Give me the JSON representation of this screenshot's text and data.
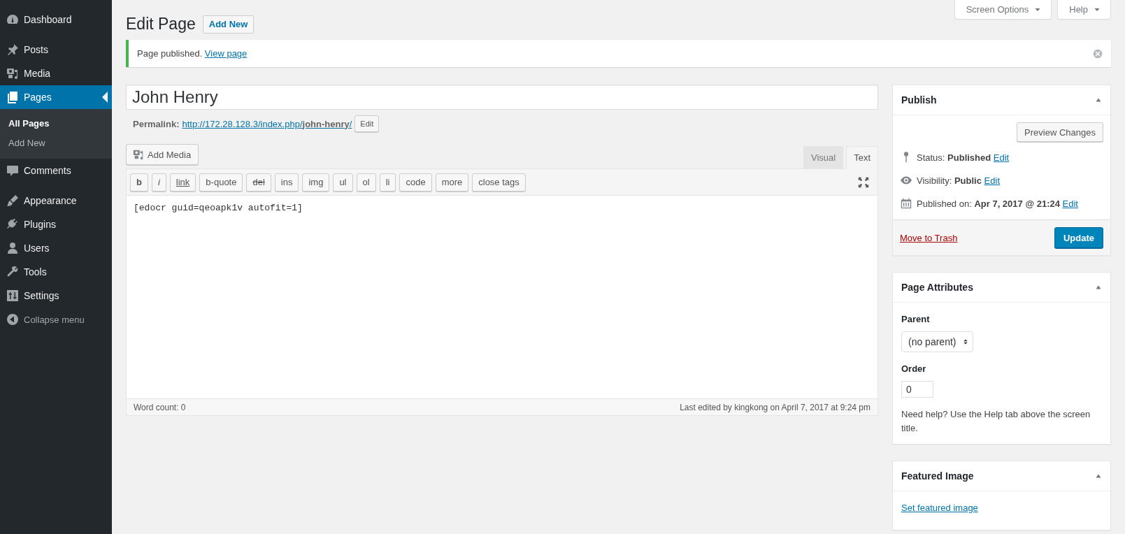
{
  "sidebar": {
    "items": [
      {
        "kind": "menu",
        "label": "Dashboard",
        "selected": false
      },
      {
        "kind": "separator"
      },
      {
        "kind": "menu",
        "label": "Posts",
        "selected": false
      },
      {
        "kind": "menu",
        "label": "Media",
        "selected": false
      },
      {
        "kind": "menu",
        "label": "Pages",
        "selected": true,
        "children": [
          {
            "label": "All Pages",
            "selected": true
          },
          {
            "label": "Add New",
            "selected": false
          }
        ]
      },
      {
        "kind": "menu",
        "label": "Comments",
        "selected": false
      },
      {
        "kind": "separator"
      },
      {
        "kind": "menu",
        "label": "Appearance",
        "selected": false
      },
      {
        "kind": "menu",
        "label": "Plugins",
        "selected": false
      },
      {
        "kind": "menu",
        "label": "Users",
        "selected": false
      },
      {
        "kind": "menu",
        "label": "Tools",
        "selected": false
      },
      {
        "kind": "menu",
        "label": "Settings",
        "selected": false
      }
    ],
    "collapse": "Collapse menu"
  },
  "screen_meta": [
    "Screen Options",
    "Help"
  ],
  "heading": {
    "title": "Edit Page",
    "add_new": "Add New"
  },
  "notice": {
    "message": "Page published.",
    "link": "View page"
  },
  "post_title": "John Henry",
  "permalink": {
    "label": "Permalink:",
    "url": "http://172.28.128.3/index.php/**john-henry**/",
    "edit": "Edit"
  },
  "editor": {
    "add_media": "Add Media",
    "tabs": [
      {
        "label": "Visual",
        "selected": false
      },
      {
        "label": "Text",
        "selected": true
      }
    ],
    "quicktags": [
      {
        "label": "b",
        "kind": "bold"
      },
      {
        "label": "i",
        "kind": "italic"
      },
      {
        "label": "link",
        "kind": "underline"
      },
      {
        "label": "b-quote",
        "kind": "plain"
      },
      {
        "label": "del",
        "kind": "strike"
      },
      {
        "label": "ins",
        "kind": "plain"
      },
      {
        "label": "img",
        "kind": "plain"
      },
      {
        "label": "ul",
        "kind": "plain"
      },
      {
        "label": "ol",
        "kind": "plain"
      },
      {
        "label": "li",
        "kind": "plain"
      },
      {
        "label": "code",
        "kind": "plain"
      },
      {
        "label": "more",
        "kind": "plain"
      },
      {
        "label": "close tags",
        "kind": "plain"
      }
    ],
    "content": "[edocr guid=qeoapk1v autofit=1]",
    "word_count": "Word count: 0",
    "last_edited": "Last edited by kingkong on April 7, 2017 at 9:24 pm"
  },
  "publish": {
    "title": "Publish",
    "preview": "Preview Changes",
    "rows": [
      {
        "kind": "status",
        "text": "Status: **Published**",
        "edit": "Edit"
      },
      {
        "kind": "visibility",
        "text": "Visibility: **Public**",
        "edit": "Edit"
      },
      {
        "kind": "date",
        "text": "Published on: **Apr 7, 2017 @ 21:24**",
        "edit": "Edit"
      }
    ],
    "trash": "Move to Trash",
    "update": "Update"
  },
  "page_attributes": {
    "title": "Page Attributes",
    "parent_label": "Parent",
    "parent_value": "(no parent)",
    "order_label": "Order",
    "order_value": "0",
    "help": "Need help? Use the Help tab above the screen title."
  },
  "featured_image": {
    "title": "Featured Image",
    "link": "Set featured image"
  }
}
